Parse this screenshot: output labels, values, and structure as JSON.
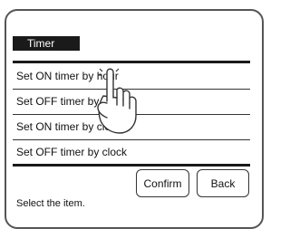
{
  "screen": {
    "title": "Timer",
    "items": [
      {
        "label": "Set ON timer by hour"
      },
      {
        "label": "Set OFF timer by hour"
      },
      {
        "label": "Set ON timer by clock"
      },
      {
        "label": "Set OFF timer by clock"
      }
    ],
    "confirm_label": "Confirm",
    "back_label": "Back",
    "status_text": "Select the item."
  },
  "icons": {
    "pointer": "pointing-hand-icon"
  },
  "colors": {
    "title_bg": "#1a1a1a",
    "title_fg": "#ffffff",
    "rule": "#1a1a1a"
  }
}
